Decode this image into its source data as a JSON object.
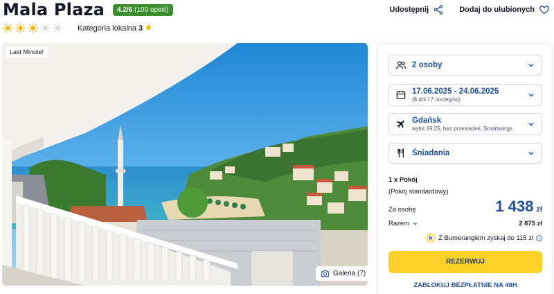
{
  "hotel": {
    "name": "Mala Plaza",
    "rating": "4.2/6",
    "reviews": "(100 opinii)",
    "stars_filled": 3,
    "stars_total": 5,
    "category_label": "Kategoria lokalna",
    "category_value": "3"
  },
  "header_actions": {
    "share_label": "Udostępnij",
    "favorite_label": "Dodaj do ulubionych"
  },
  "photo": {
    "badge": "Last Minute!",
    "gallery_label": "Galeria (7)"
  },
  "booking": {
    "persons": {
      "label": "2 osoby",
      "icon": "people-icon"
    },
    "dates": {
      "label": "17.06.2025 - 24.06.2025",
      "sub": "(8 dni / 7 noclegów)",
      "icon": "calendar-icon"
    },
    "flight": {
      "label": "Gdańsk",
      "sub": "wylot 19:25, bez przesiadek, Smartwings",
      "icon": "plane-icon"
    },
    "board": {
      "label": "Śniadania",
      "icon": "cutlery-icon"
    },
    "room_count": "1 x Pokój",
    "room_type": "(Pokój standardowy)",
    "per_person_label": "Za osobę",
    "per_person_price": "1 438",
    "currency": "zł",
    "total_label": "Razem",
    "total_price": "2 875 zł",
    "bumerang_text": "Z Bumerangiem zyskaj do 115 zł",
    "reserve_label": "REZERWUJ",
    "block_label": "ZABLOKUJ BEZPŁATNIE NA 48H"
  },
  "colors": {
    "accent_blue": "#1e4fa3",
    "rating_green": "#3a8f2a",
    "cta_yellow": "#fcd22a",
    "star_yellow": "#f5b80a"
  }
}
